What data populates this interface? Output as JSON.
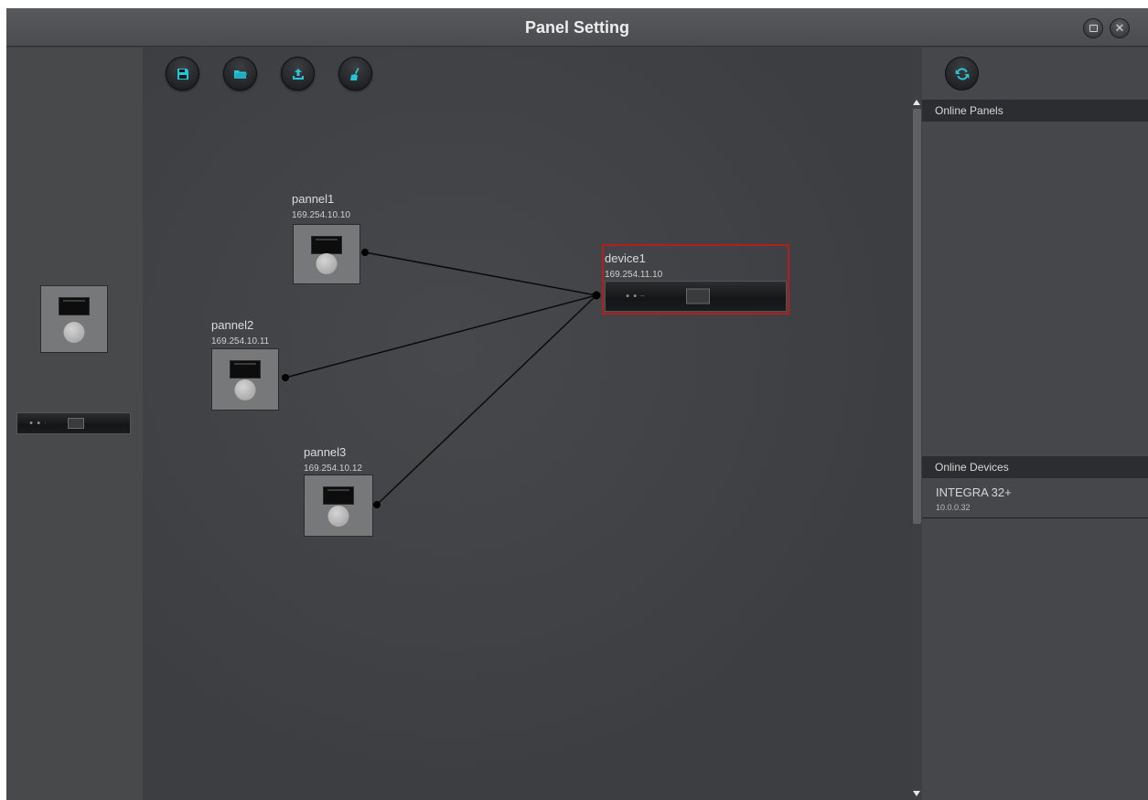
{
  "window": {
    "title": "Panel Setting"
  },
  "toolbar": {
    "buttons": [
      {
        "icon": "save-icon"
      },
      {
        "icon": "folder-open-icon"
      },
      {
        "icon": "upload-icon"
      },
      {
        "icon": "broom-icon"
      }
    ],
    "accent_color": "#27c4d4"
  },
  "library": {
    "items": [
      {
        "type": "panel",
        "icon": "panel-device-icon"
      },
      {
        "type": "rack-device",
        "icon": "rack-device-icon"
      }
    ]
  },
  "canvas": {
    "panels": [
      {
        "name": "pannel1",
        "ip": "169.254.10.10"
      },
      {
        "name": "pannel2",
        "ip": "169.254.10.11"
      },
      {
        "name": "pannel3",
        "ip": "169.254.10.12"
      }
    ],
    "device": {
      "name": "device1",
      "ip": "169.254.11.10",
      "selected_color": "#b31e1e"
    }
  },
  "sidebar": {
    "online_panels_header": "Online Panels",
    "online_devices_header": "Online Devices",
    "devices": [
      {
        "name": "INTEGRA 32+",
        "ip": "10.0.0.32"
      }
    ]
  }
}
